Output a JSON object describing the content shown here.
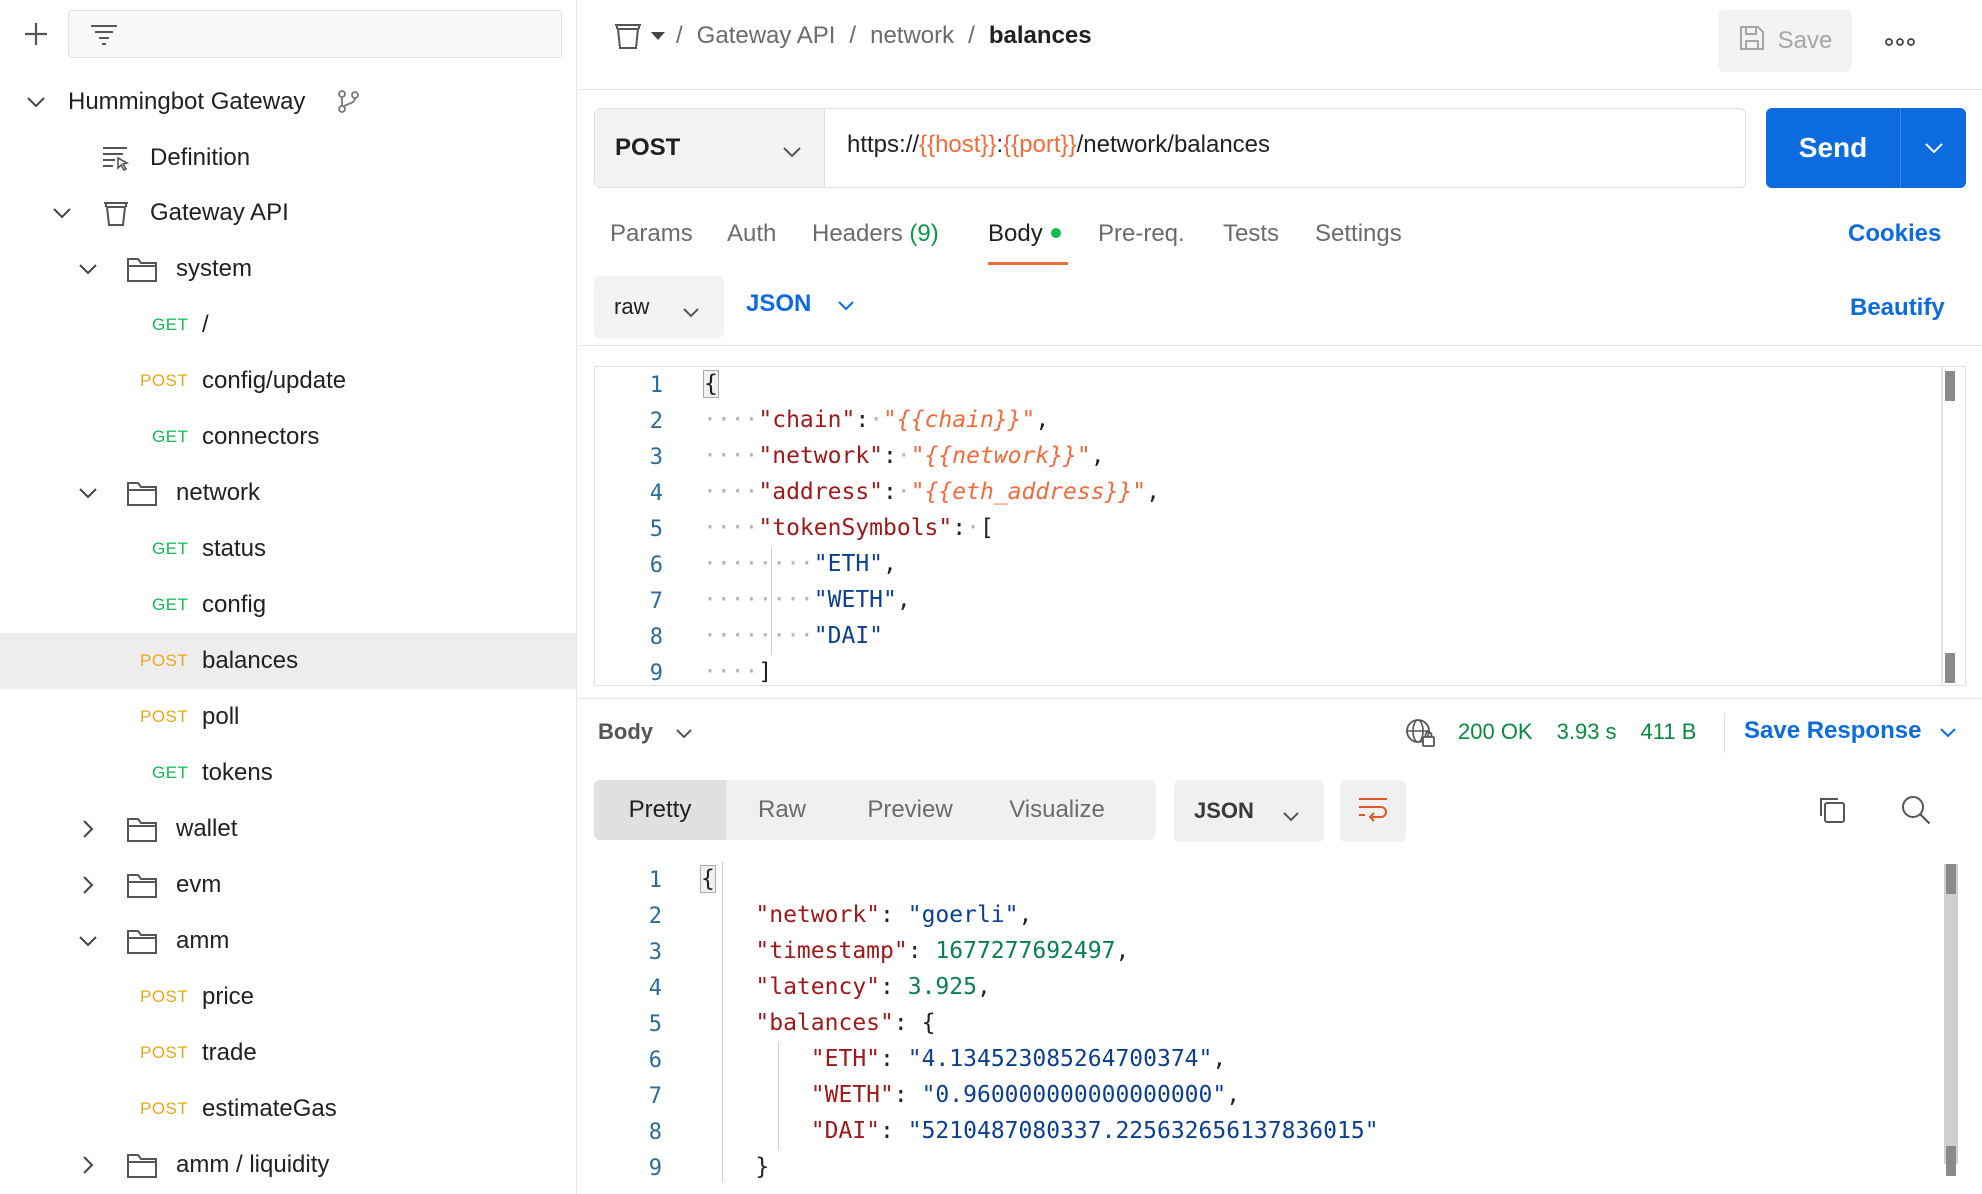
{
  "sidebar": {
    "workspace": {
      "label": "Hummingbot Gateway",
      "icon": "fork-icon"
    },
    "definition": {
      "label": "Definition"
    },
    "collection": {
      "label": "Gateway API"
    },
    "folders": {
      "system": "system",
      "network": "network",
      "wallet": "wallet",
      "evm": "evm",
      "amm": "amm",
      "amm_liquidity": "amm / liquidity"
    },
    "requests": {
      "sys_root": {
        "method": "GET",
        "label": "/"
      },
      "sys_config_update": {
        "method": "POST",
        "label": "config/update"
      },
      "sys_connectors": {
        "method": "GET",
        "label": "connectors"
      },
      "net_status": {
        "method": "GET",
        "label": "status"
      },
      "net_config": {
        "method": "GET",
        "label": "config"
      },
      "net_balances": {
        "method": "POST",
        "label": "balances"
      },
      "net_poll": {
        "method": "POST",
        "label": "poll"
      },
      "net_tokens": {
        "method": "GET",
        "label": "tokens"
      },
      "amm_price": {
        "method": "POST",
        "label": "price"
      },
      "amm_trade": {
        "method": "POST",
        "label": "trade"
      },
      "amm_estimate": {
        "method": "POST",
        "label": "estimateGas"
      }
    }
  },
  "header": {
    "breadcrumb": [
      "Gateway API",
      "network",
      "balances"
    ],
    "separator": "/",
    "save_label": "Save"
  },
  "request": {
    "method": "POST",
    "url_prefix": "https://",
    "url_var_host": "{{host}}",
    "url_colon": ":",
    "url_var_port": "{{port}}",
    "url_path": "/network/balances",
    "send_label": "Send"
  },
  "request_tabs": {
    "params": "Params",
    "auth": "Auth",
    "headers": "Headers",
    "headers_count": "(9)",
    "body": "Body",
    "prereq": "Pre-req.",
    "tests": "Tests",
    "settings": "Settings",
    "cookies": "Cookies"
  },
  "body_toolbar": {
    "mode": "raw",
    "format": "JSON",
    "beautify": "Beautify"
  },
  "request_body": {
    "line_numbers": [
      "1",
      "2",
      "3",
      "4",
      "5",
      "6",
      "7",
      "8",
      "9"
    ],
    "chain_key": "\"chain\"",
    "chain_val": "\"{{chain}}\"",
    "network_key": "\"network\"",
    "network_val": "\"{{network}}\"",
    "address_key": "\"address\"",
    "address_val": "\"{{eth_address}}\"",
    "tokens_key": "\"tokenSymbols\"",
    "token1": "\"ETH\"",
    "token2": "\"WETH\"",
    "token3": "\"DAI\""
  },
  "response": {
    "body_label": "Body",
    "status": "200 OK",
    "time": "3.93 s",
    "size": "411 B",
    "save_response": "Save Response",
    "views": [
      "Pretty",
      "Raw",
      "Preview",
      "Visualize"
    ],
    "format": "JSON",
    "line_numbers": [
      "1",
      "2",
      "3",
      "4",
      "5",
      "6",
      "7",
      "8",
      "9"
    ],
    "network_key": "\"network\"",
    "network_val": "\"goerli\"",
    "timestamp_key": "\"timestamp\"",
    "timestamp_val": "1677277692497",
    "latency_key": "\"latency\"",
    "latency_val": "3.925",
    "balances_key": "\"balances\"",
    "eth_key": "\"ETH\"",
    "eth_val": "\"4.134523085264700374\"",
    "weth_key": "\"WETH\"",
    "weth_val": "\"0.960000000000000000\"",
    "dai_key": "\"DAI\"",
    "dai_val": "\"5210487080337.225632656137836015\""
  },
  "colors": {
    "accent": "#0b6bdf",
    "get": "#0cbb52",
    "post": "#eaa71a",
    "variable": "#f26b3a",
    "status_ok": "#0a8a3f"
  }
}
